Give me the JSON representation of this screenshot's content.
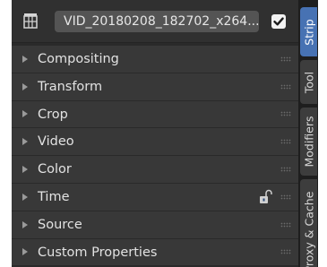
{
  "header": {
    "strip_name": "VID_20180208_182702_x264...",
    "icon": "film-strip-icon",
    "mute_checked": true
  },
  "panels": [
    {
      "label": "Compositing"
    },
    {
      "label": "Transform"
    },
    {
      "label": "Crop"
    },
    {
      "label": "Video"
    },
    {
      "label": "Color"
    },
    {
      "label": "Time"
    },
    {
      "label": "Source"
    },
    {
      "label": "Custom Properties"
    }
  ],
  "tabs": [
    {
      "label": "Strip",
      "active": true
    },
    {
      "label": "Tool",
      "active": false
    },
    {
      "label": "Modifiers",
      "active": false
    },
    {
      "label": "Proxy & Cache",
      "active": false
    }
  ],
  "colors": {
    "active_tab": "#4772b3",
    "panel_background": "#383838",
    "header_background": "#303030"
  }
}
